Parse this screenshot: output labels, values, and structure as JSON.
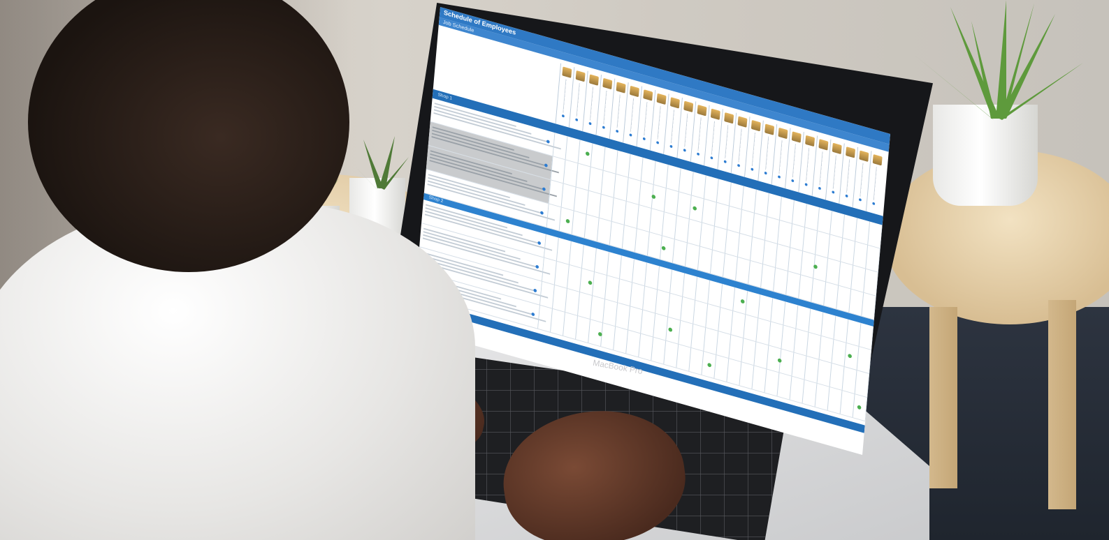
{
  "screen": {
    "app_title": "Schedule of Employees",
    "app_subtitle": "Job Schedule",
    "band_1": "Shop 1",
    "band_2": "Shop 2"
  },
  "laptop": {
    "lid_label": "MacBook Pro"
  },
  "schedule": {
    "employee_columns": 24,
    "rows": [
      {
        "shaded": false,
        "dot_columns": [
          2
        ]
      },
      {
        "shaded": true,
        "dot_columns": [
          7,
          10
        ]
      },
      {
        "shaded": true,
        "dot_columns": [
          19
        ]
      },
      {
        "shaded": false,
        "dot_columns": [
          1,
          8
        ]
      },
      {
        "shaded": false,
        "dot_columns": [
          14
        ]
      },
      {
        "shaded": false,
        "dot_columns": [
          3,
          22
        ]
      },
      {
        "shaded": false,
        "dot_columns": [
          9,
          17
        ]
      },
      {
        "shaded": false,
        "dot_columns": [
          4,
          12,
          23
        ]
      }
    ]
  },
  "colors": {
    "header_blue": "#2f79c4",
    "band_blue": "#236fb8",
    "assignment_green": "#4caf50",
    "marker_blue": "#2d7cd1"
  }
}
